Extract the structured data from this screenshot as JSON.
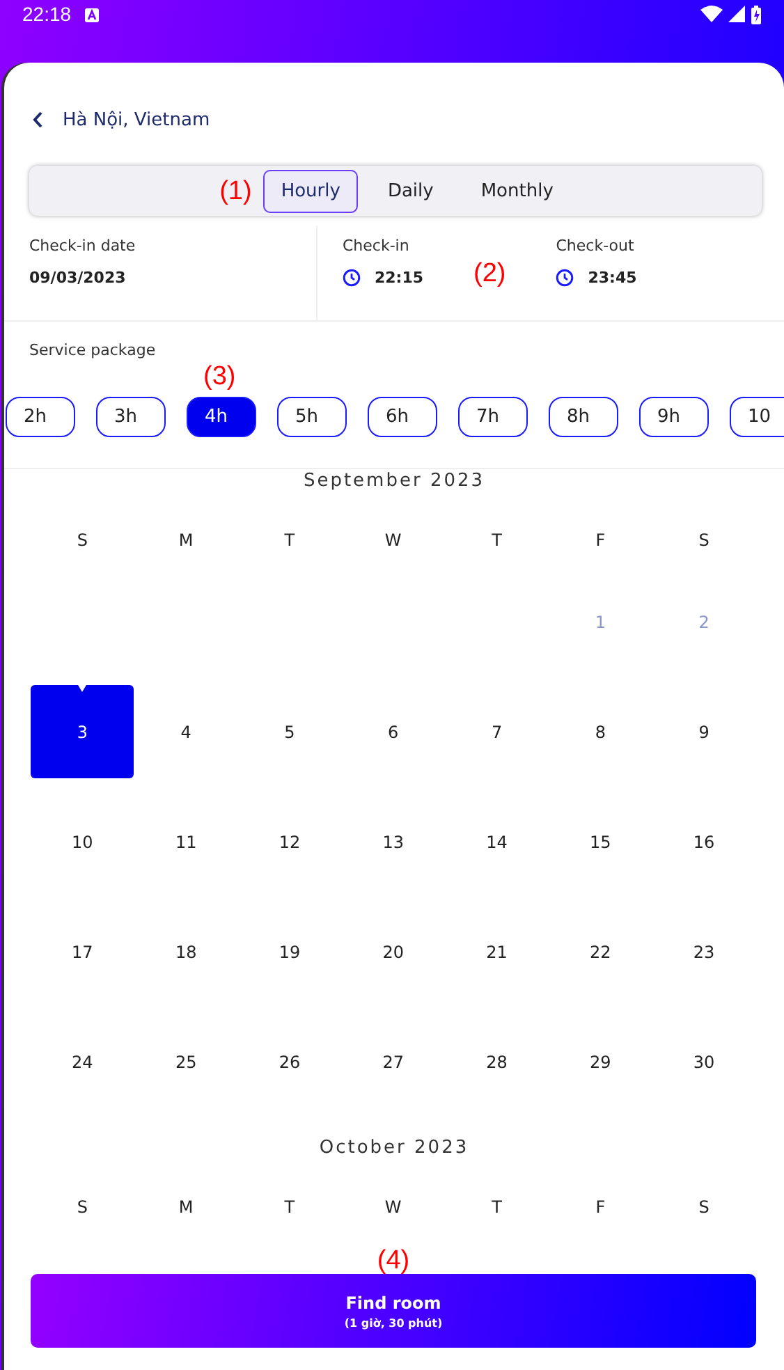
{
  "status_bar": {
    "time": "22:18"
  },
  "header": {
    "title": "Hà Nội, Vietnam"
  },
  "segmented": {
    "annotation": "(1)",
    "tabs": [
      {
        "label": "Hourly",
        "selected": true
      },
      {
        "label": "Daily",
        "selected": false
      },
      {
        "label": "Monthly",
        "selected": false
      }
    ]
  },
  "booking": {
    "date_label": "Check-in date",
    "date_value": "09/03/2023",
    "checkin_label": "Check-in",
    "checkin_value": "22:15",
    "annotation": "(2)",
    "checkout_label": "Check-out",
    "checkout_value": "23:45"
  },
  "packages": {
    "label": "Service package",
    "annotation": "(3)",
    "items": [
      {
        "label": "2h",
        "selected": false
      },
      {
        "label": "3h",
        "selected": false
      },
      {
        "label": "4h",
        "selected": true
      },
      {
        "label": "5h",
        "selected": false
      },
      {
        "label": "6h",
        "selected": false
      },
      {
        "label": "7h",
        "selected": false
      },
      {
        "label": "8h",
        "selected": false
      },
      {
        "label": "9h",
        "selected": false
      },
      {
        "label": "10",
        "selected": false
      }
    ]
  },
  "months": [
    {
      "title": "September 2023",
      "weekdays": [
        "S",
        "M",
        "T",
        "W",
        "T",
        "F",
        "S"
      ],
      "weeks": [
        {
          "right_aligned": true,
          "days": [
            {
              "day": "1",
              "disabled": true,
              "selected": false
            },
            {
              "day": "2",
              "disabled": true,
              "selected": false
            }
          ]
        },
        [
          {
            "day": "3",
            "disabled": false,
            "selected": true
          },
          {
            "day": "4",
            "disabled": false,
            "selected": false
          },
          {
            "day": "5",
            "disabled": false,
            "selected": false
          },
          {
            "day": "6",
            "disabled": false,
            "selected": false
          },
          {
            "day": "7",
            "disabled": false,
            "selected": false
          },
          {
            "day": "8",
            "disabled": false,
            "selected": false
          },
          {
            "day": "9",
            "disabled": false,
            "selected": false
          }
        ],
        [
          {
            "day": "10",
            "disabled": false,
            "selected": false
          },
          {
            "day": "11",
            "disabled": false,
            "selected": false
          },
          {
            "day": "12",
            "disabled": false,
            "selected": false
          },
          {
            "day": "13",
            "disabled": false,
            "selected": false
          },
          {
            "day": "14",
            "disabled": false,
            "selected": false
          },
          {
            "day": "15",
            "disabled": false,
            "selected": false
          },
          {
            "day": "16",
            "disabled": false,
            "selected": false
          }
        ],
        [
          {
            "day": "17",
            "disabled": false,
            "selected": false
          },
          {
            "day": "18",
            "disabled": false,
            "selected": false
          },
          {
            "day": "19",
            "disabled": false,
            "selected": false
          },
          {
            "day": "20",
            "disabled": false,
            "selected": false
          },
          {
            "day": "21",
            "disabled": false,
            "selected": false
          },
          {
            "day": "22",
            "disabled": false,
            "selected": false
          },
          {
            "day": "23",
            "disabled": false,
            "selected": false
          }
        ],
        [
          {
            "day": "24",
            "disabled": false,
            "selected": false
          },
          {
            "day": "25",
            "disabled": false,
            "selected": false
          },
          {
            "day": "26",
            "disabled": false,
            "selected": false
          },
          {
            "day": "27",
            "disabled": false,
            "selected": false
          },
          {
            "day": "28",
            "disabled": false,
            "selected": false
          },
          {
            "day": "29",
            "disabled": false,
            "selected": false
          },
          {
            "day": "30",
            "disabled": false,
            "selected": false
          }
        ]
      ]
    },
    {
      "title": "October 2023",
      "weekdays": [
        "S",
        "M",
        "T",
        "W",
        "T",
        "F",
        "S"
      ]
    }
  ],
  "find_button": {
    "annotation": "(4)",
    "label": "Find room",
    "sublabel": "(1 giờ, 30 phút)"
  }
}
